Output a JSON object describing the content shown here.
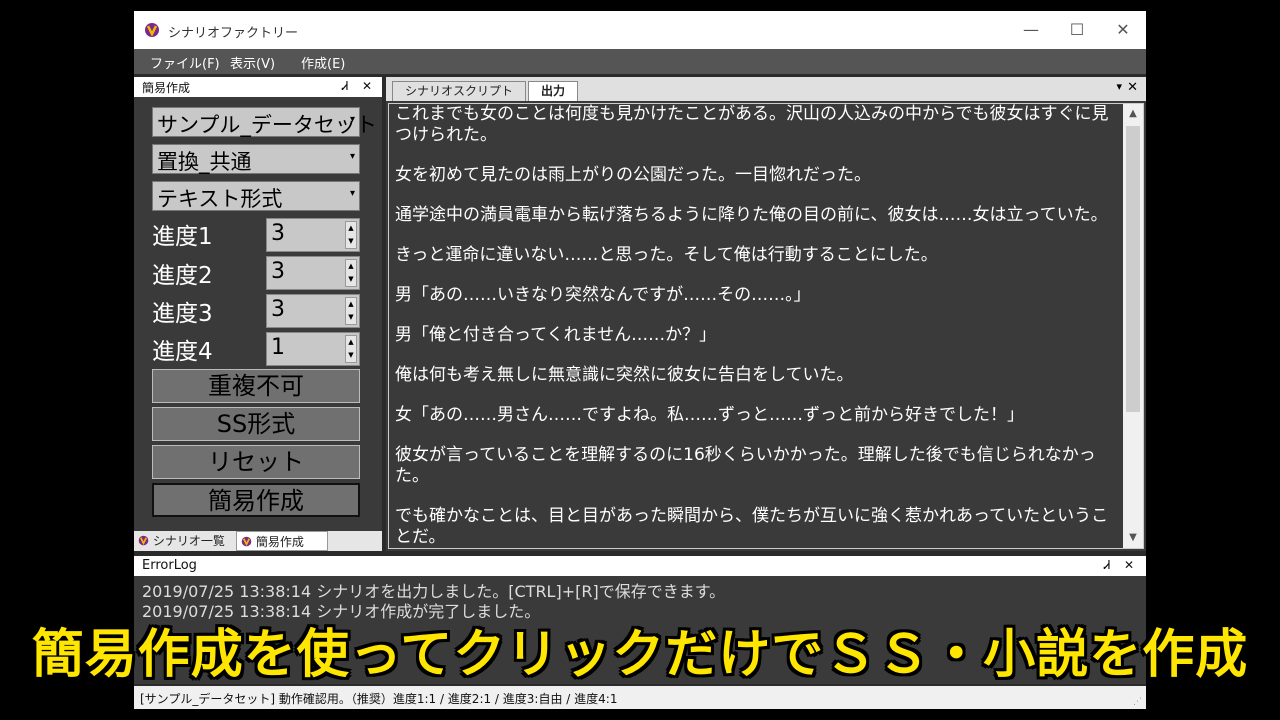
{
  "window": {
    "title": "シナリオファクトリー",
    "minimize": "—",
    "maximize": "☐",
    "close": "✕"
  },
  "menu": [
    "ファイル(F)",
    "表示(V)",
    "作成(E)"
  ],
  "left_panel": {
    "title": "簡易作成",
    "pin": "Ꮧ",
    "close": "✕",
    "dropdowns": [
      {
        "value": "サンプル_データセット"
      },
      {
        "value": "置換_共通"
      },
      {
        "value": "テキスト形式"
      }
    ],
    "dropdown_arrow": "▾",
    "progress": [
      {
        "label": "進度1",
        "value": "3"
      },
      {
        "label": "進度2",
        "value": "3"
      },
      {
        "label": "進度3",
        "value": "3"
      },
      {
        "label": "進度4",
        "value": "1"
      }
    ],
    "spin_up": "▲",
    "spin_down": "▼",
    "buttons": [
      "重複不可",
      "SS形式",
      "リセット",
      "簡易作成"
    ],
    "tabs": [
      "シナリオ一覧",
      "簡易作成"
    ],
    "active_tab": 1
  },
  "document": {
    "tabs": [
      "シナリオスクリプト",
      "出力"
    ],
    "active_tab": 1,
    "tab_menu": "▾",
    "tab_close": "✕",
    "paragraphs": [
      "これまでも女のことは何度も見かけたことがある。沢山の人込みの中からでも彼女はすぐに見つけられた。",
      "女を初めて見たのは雨上がりの公園だった。一目惚れだった。",
      "通学途中の満員電車から転げ落ちるように降りた俺の目の前に、彼女は……女は立っていた。",
      "きっと運命に違いない……と思った。そして俺は行動することにした。",
      "男「あの……いきなり突然なんですが……その……。」",
      "男「俺と付き合ってくれません……か？」",
      "俺は何も考え無しに無意識に突然に彼女に告白をしていた。",
      "女「あの……男さん……ですよね。私……ずっと……ずっと前から好きでした！」",
      "彼女が言っていることを理解するのに16秒くらいかかった。理解した後でも信じられなかった。",
      "でも確かなことは、目と目があった瞬間から、僕たちが互いに強く惹かれあっていたということだ。"
    ],
    "scroll_up": "▲",
    "scroll_down": "▼"
  },
  "error_log": {
    "title": "ErrorLog",
    "pin": "Ꮧ",
    "close": "✕",
    "lines": [
      "2019/07/25 13:38:14 シナリオを出力しました。[CTRL]+[R]で保存できます。",
      "2019/07/25 13:38:14 シナリオ作成が完了しました。"
    ]
  },
  "status_bar": {
    "text": "[サンプル_データセット] 動作確認用。（推奨）進度1:1 / 進度2:1 / 進度3:自由 / 進度4:1",
    "grip": "⋰"
  },
  "caption": "簡易作成を使ってクリックだけでＳＳ・小説を作成",
  "colors": {
    "caption": "#ffe600",
    "background": "#3a3a3a",
    "menubar": "#555555"
  }
}
